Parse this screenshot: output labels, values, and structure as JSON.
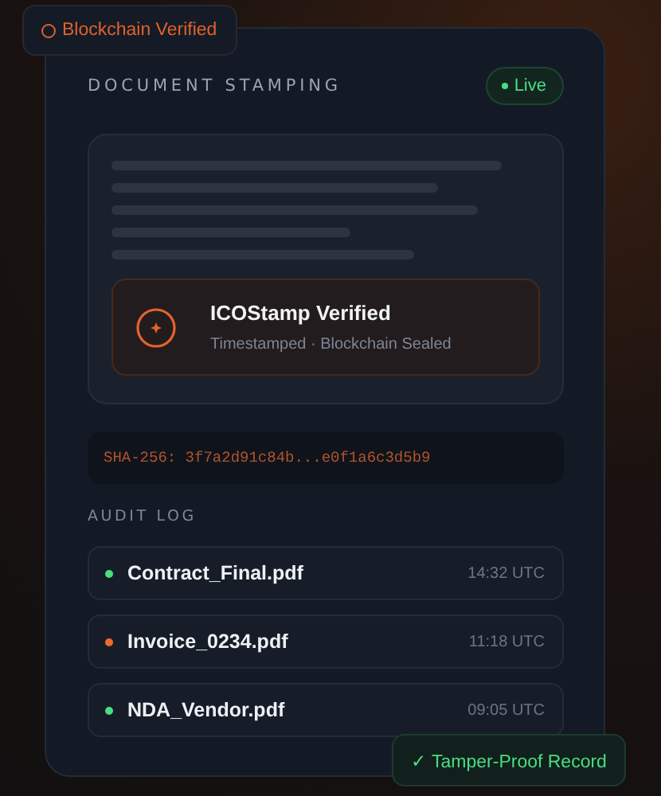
{
  "top_badge": {
    "text": "Blockchain Verified"
  },
  "panel": {
    "title": "DOCUMENT STAMPING",
    "status": {
      "text": "Live",
      "color": "#4ade80"
    }
  },
  "stamp": {
    "title": "ICOStamp Verified",
    "subtitle": "Timestamped · Blockchain Sealed"
  },
  "hash": "SHA-256: 3f7a2d91c84b...e0f1a6c3d5b9",
  "audit_log": {
    "title": "AUDIT LOG",
    "entries": [
      {
        "file": "Contract_Final.pdf",
        "time": "14:32 UTC",
        "color": "#4ade80"
      },
      {
        "file": "Invoice_0234.pdf",
        "time": "11:18 UTC",
        "color": "#f26b2a"
      },
      {
        "file": "NDA_Vendor.pdf",
        "time": "09:05 UTC",
        "color": "#4ade80"
      }
    ]
  },
  "bottom_badge": {
    "text": "✓ Tamper-Proof Record"
  }
}
